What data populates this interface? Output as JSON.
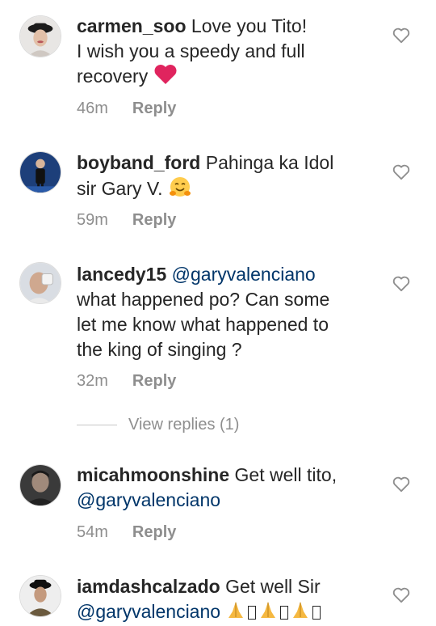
{
  "comments": [
    {
      "username": "carmen_soo",
      "text_line1": "Love you Tito!",
      "text_line2": "I wish you a speedy and full",
      "text_line3": "recovery",
      "emoji": "red-heart",
      "time": "46m",
      "reply": "Reply"
    },
    {
      "username": "boyband_ford",
      "text_line1": "Pahinga ka Idol",
      "text_line2": "sir Gary V.",
      "emoji": "hugging-face",
      "time": "59m",
      "reply": "Reply"
    },
    {
      "username": "lancedy15",
      "mention": "@garyvalenciano",
      "text_line2": "what happened po? Can some",
      "text_line3": "let me know what happened to",
      "text_line4": "the king of singing ?",
      "time": "32m",
      "reply": "Reply",
      "view_replies": "View replies (1)"
    },
    {
      "username": "micahmoonshine",
      "text_line1": "Get well tito,",
      "mention": "@garyvalenciano",
      "time": "54m",
      "reply": "Reply"
    },
    {
      "username": "iamdashcalzado",
      "text_line1": "Get well Sir",
      "mention": "@garyvalenciano",
      "emoji": "folded-hands"
    }
  ],
  "colors": {
    "text": "#262626",
    "meta": "#8e8e8e",
    "mention": "#003569",
    "heart_emoji": "#e0245e",
    "hug_emoji": "#ffcc4d",
    "pray_emoji": "#f5b841"
  }
}
